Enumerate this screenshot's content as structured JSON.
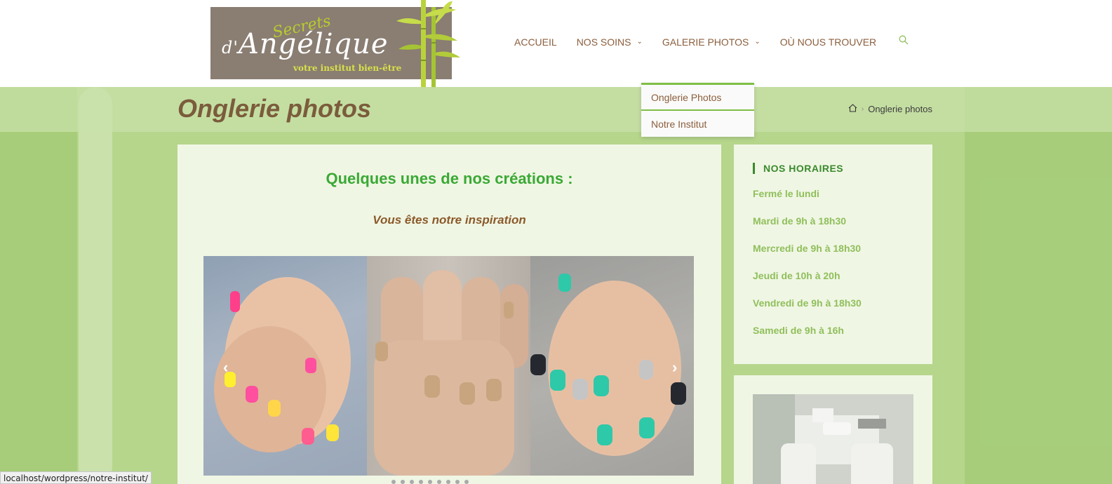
{
  "brand": {
    "logo_top": "Secrets",
    "logo_prefix": "d'",
    "logo_name": "Angélique",
    "logo_tagline": "votre institut bien-être"
  },
  "nav": {
    "items": [
      {
        "label": "ACCUEIL",
        "has_chevron": false
      },
      {
        "label": "NOS SOINS",
        "has_chevron": true
      },
      {
        "label": "GALERIE PHOTOS",
        "has_chevron": true
      },
      {
        "label": "OÙ NOUS TROUVER",
        "has_chevron": false
      }
    ],
    "search_icon": "search-icon"
  },
  "dropdown": {
    "items": [
      "Onglerie Photos",
      "Notre Institut"
    ]
  },
  "page": {
    "title": "Onglerie photos",
    "breadcrumb_current": "Onglerie photos",
    "breadcrumb_home_icon": "home-icon"
  },
  "main": {
    "heading": "Quelques unes de nos créations :",
    "subheading": "Vous êtes notre inspiration",
    "slider_dot_count": 9
  },
  "sidebar": {
    "title": "NOS HORAIRES",
    "hours": [
      "Fermé le lundi",
      "Mardi de 9h à 18h30",
      "Mercredi de 9h à 18h30",
      "Jeudi de 10h à 20h",
      "Vendredi de 9h à 18h30",
      "Samedi de 9h à 16h"
    ]
  },
  "statusbar": {
    "url": "localhost/wordpress/notre-institut/"
  },
  "colors": {
    "accent_green": "#3aa935",
    "brown": "#8b5e3c",
    "light_green": "#b6d68c"
  }
}
